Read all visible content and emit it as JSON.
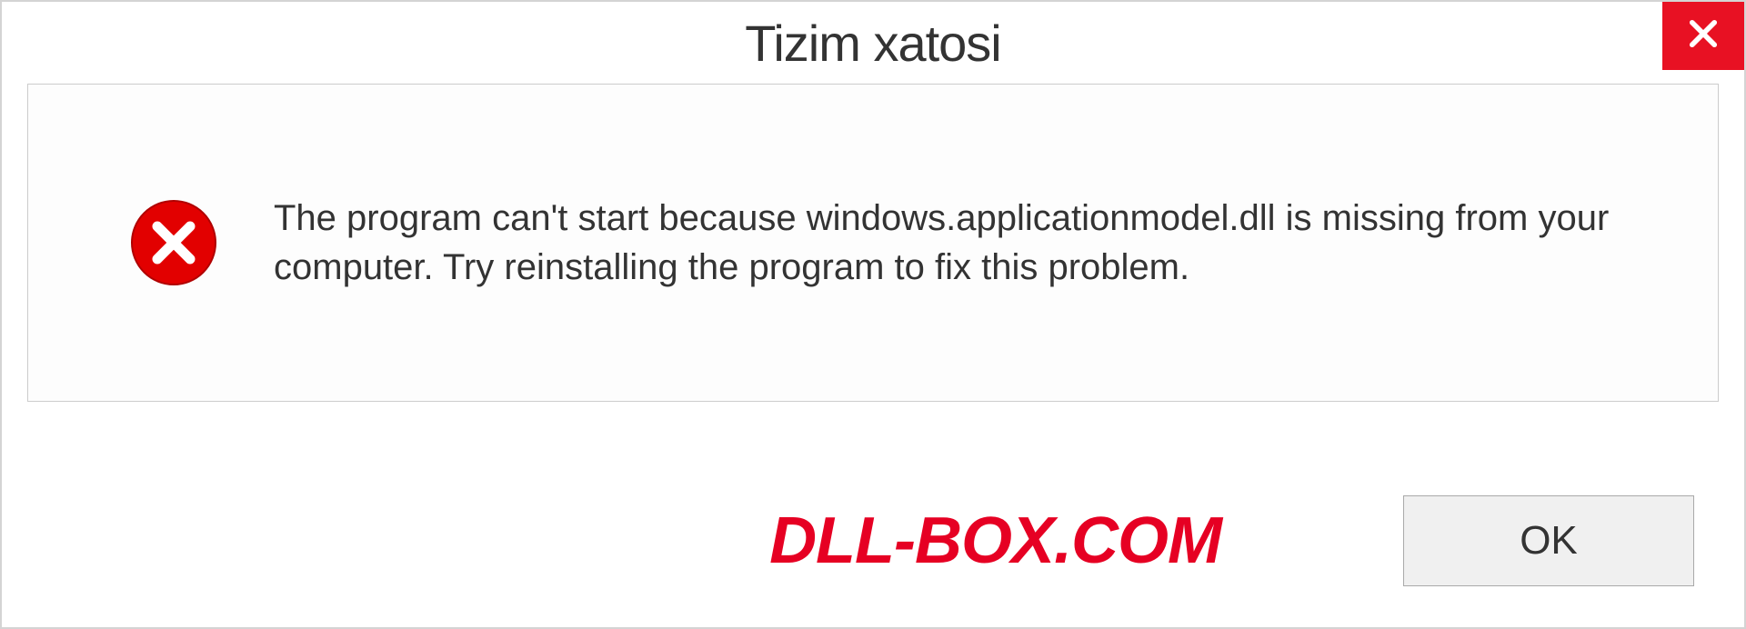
{
  "dialog": {
    "title": "Tizim xatosi",
    "message": "The program can't start because windows.applicationmodel.dll is missing from your computer. Try reinstalling the program to fix this problem.",
    "ok_label": "OK"
  },
  "watermark": "DLL-BOX.COM",
  "colors": {
    "close_bg": "#e81123",
    "error_icon": "#e20000",
    "watermark": "#e60023"
  },
  "icons": {
    "close": "close-icon",
    "error": "error-circle-x-icon"
  }
}
